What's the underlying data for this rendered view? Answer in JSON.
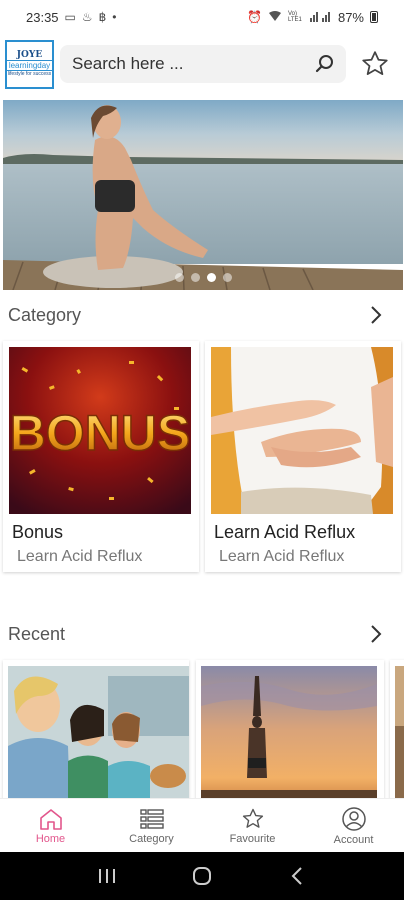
{
  "status_bar": {
    "time": "23:35",
    "battery": "87%",
    "network_label": "Vo) LTE1"
  },
  "header": {
    "logo_text": [
      "JOYE",
      "learningday",
      "lifestyle for success"
    ],
    "search": {
      "placeholder": "Search here ..."
    }
  },
  "banner": {
    "slide_count": 4,
    "active_slide": 3
  },
  "category": {
    "title": "Category",
    "items": [
      {
        "title": "Bonus",
        "subtitle": "Learn Acid Reflux",
        "image": "BONUS"
      },
      {
        "title": "Learn Acid Reflux",
        "subtitle": "Learn Acid Reflux",
        "image": ""
      }
    ]
  },
  "recent": {
    "title": "Recent"
  },
  "bottom_nav": {
    "items": [
      {
        "label": "Home",
        "icon": "home-icon",
        "active": true
      },
      {
        "label": "Category",
        "icon": "category-list-icon",
        "active": false
      },
      {
        "label": "Favourite",
        "icon": "star-icon",
        "active": false
      },
      {
        "label": "Account",
        "icon": "account-icon",
        "active": false
      }
    ]
  },
  "colors": {
    "accent": "#e2568c",
    "logo_border": "#2a8fd0",
    "text_muted": "#777777"
  }
}
